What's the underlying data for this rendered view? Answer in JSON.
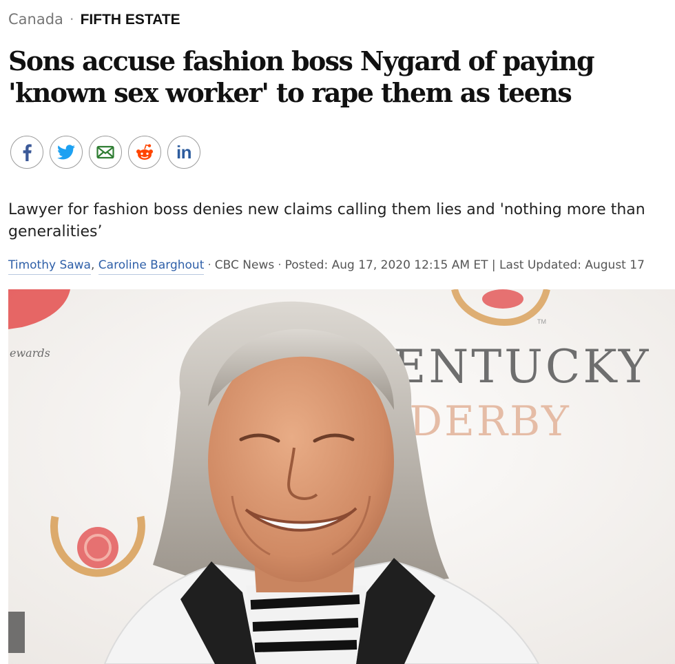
{
  "breadcrumb": {
    "section": "Canada",
    "separator": "·",
    "subsection": "FIFTH ESTATE"
  },
  "headline": "Sons accuse fashion boss Nygard of paying 'known sex worker' to rape them as teens",
  "share": [
    {
      "icon": "facebook-icon",
      "label": "f"
    },
    {
      "icon": "twitter-icon"
    },
    {
      "icon": "email-icon"
    },
    {
      "icon": "reddit-icon"
    },
    {
      "icon": "linkedin-icon",
      "label": "in"
    }
  ],
  "deck": "Lawyer for fashion boss denies new claims calling them lies and 'nothing more than generalities’",
  "byline": {
    "author1": "Timothy Sawa",
    "comma": ",",
    "author2": "Caroline Barghout",
    "dot": "·",
    "source": "CBC News",
    "posted": "Posted: Aug 17, 2020 12:15 AM ET | Last Updated: August 17"
  },
  "photo": {
    "backdrop_text_line1": "KENTUCKY",
    "backdrop_text_line2": "DERBY",
    "backdrop_small_text": "ewards",
    "trademark": "TM"
  },
  "colors": {
    "link": "#2e5fa8",
    "share_outline": "#9b9b9b",
    "facebook": "#3b5998",
    "twitter": "#1da1f2",
    "email": "#2e7d32",
    "reddit": "#ff4500",
    "linkedin": "#2d5c9e"
  }
}
